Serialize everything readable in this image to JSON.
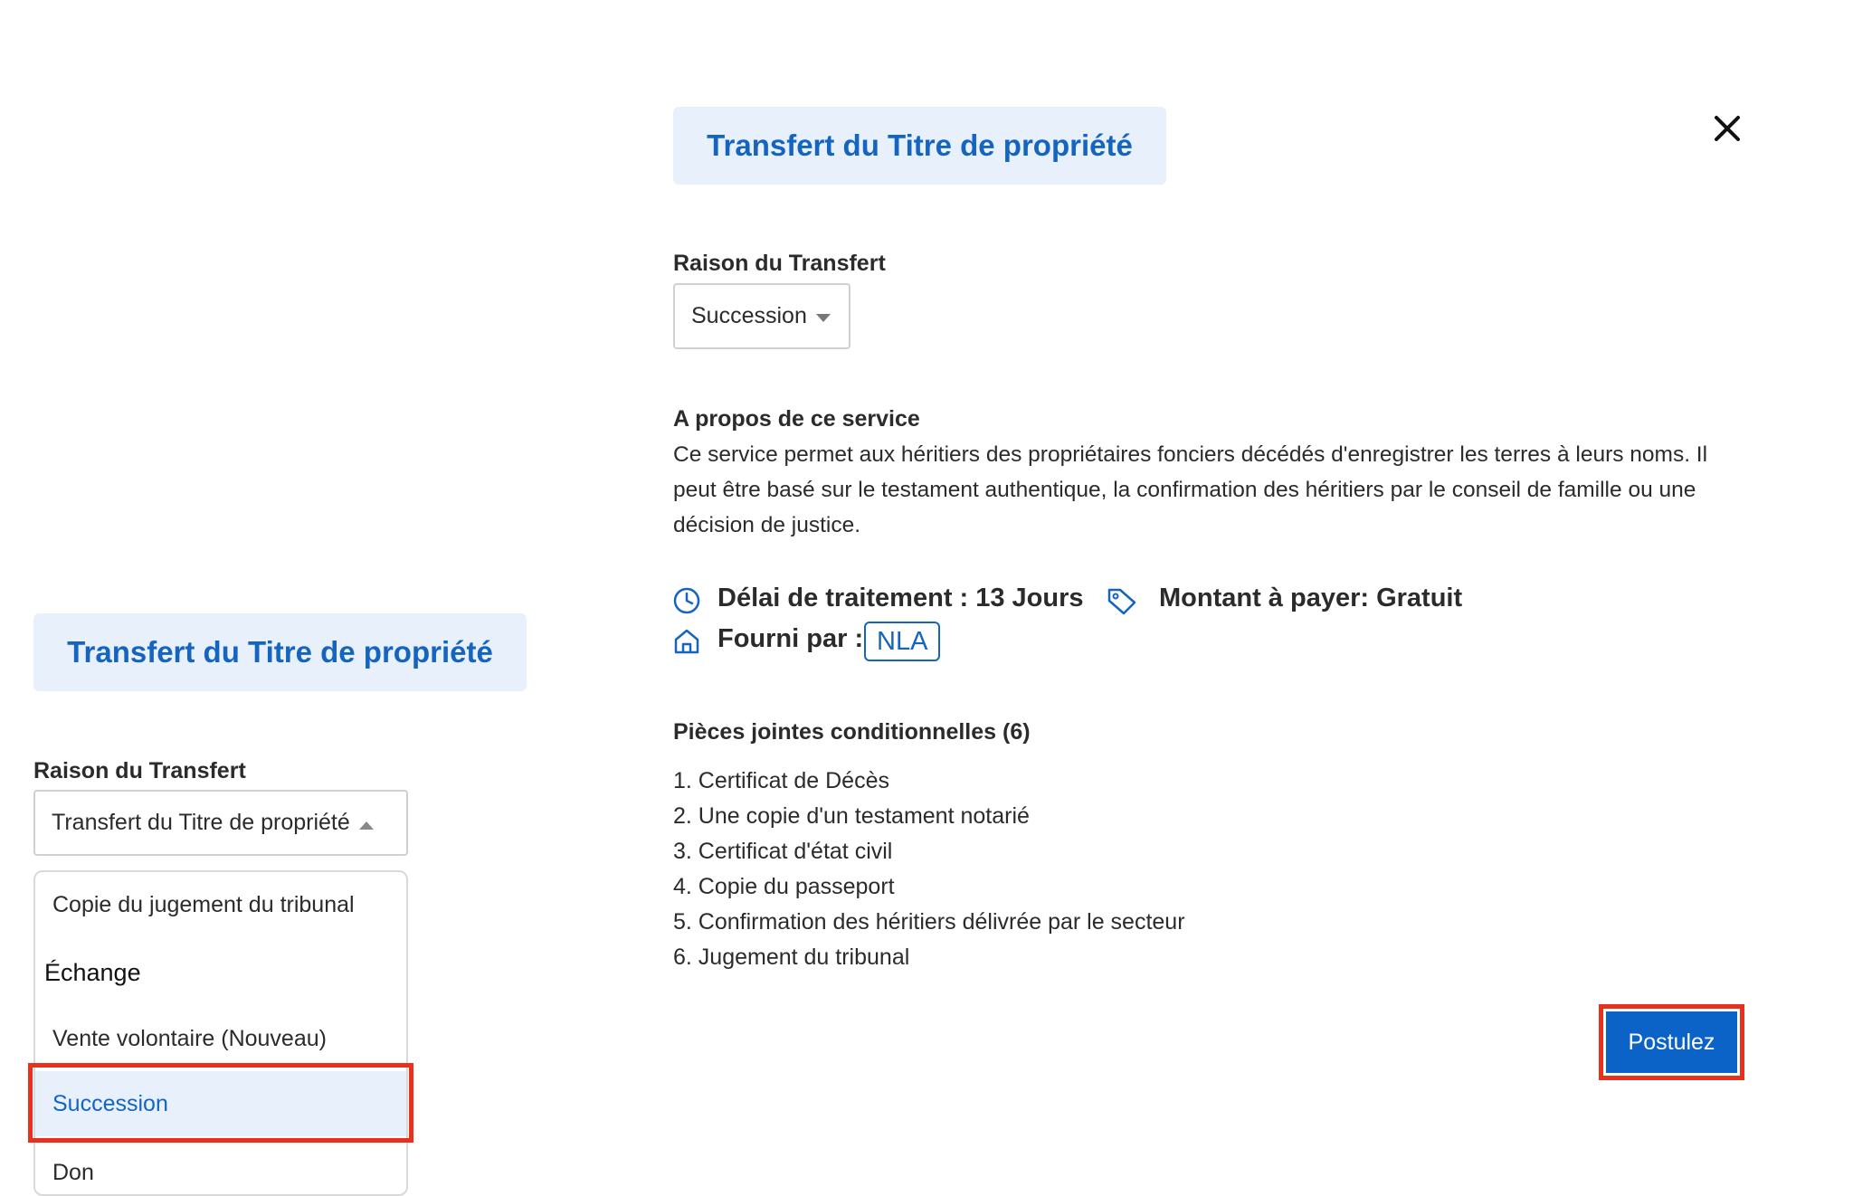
{
  "left_panel": {
    "title": "Transfert du Titre de propriété",
    "field_label": "Raison du Transfert",
    "select_value": "Transfert du Titre de propriété",
    "options": [
      "Copie du jugement du tribunal",
      "Échange",
      "Vente volontaire (Nouveau)",
      "Succession",
      "Don"
    ],
    "highlighted_option": "Succession"
  },
  "right_panel": {
    "title": "Transfert du Titre de propriété",
    "field_label": "Raison du Transfert",
    "select_value": "Succession",
    "about": {
      "heading": "A propos de ce service",
      "text": "Ce service permet aux héritiers des propriétaires fonciers décédés d'enregistrer les terres à leurs noms. Il peut être basé sur le testament authentique, la confirmation des héritiers par le conseil de famille ou une décision de justice."
    },
    "processing_time": "Délai de traitement : 13 Jours",
    "amount": "Montant à payer: Gratuit",
    "provided_by_label": "Fourni par :",
    "provider": "NLA",
    "attachments_title": "Pièces jointes conditionnelles (6)",
    "attachments": [
      "1. Certificat de Décès",
      "2. Une copie d'un testament notarié",
      "3. Certificat d'état civil",
      "4. Copie du passeport",
      "5. Confirmation des héritiers délivrée par le secteur",
      "6. Jugement du tribunal"
    ],
    "apply_button": "Postulez"
  },
  "icons": {
    "close": "close-icon",
    "clock": "clock-icon",
    "tag": "tag-icon",
    "home": "home-icon"
  },
  "colors": {
    "accent": "#1565c0",
    "title_bg": "#e8f1fb",
    "highlight_border": "#e8301c",
    "selected_option_bg": "#e8f1fb"
  }
}
